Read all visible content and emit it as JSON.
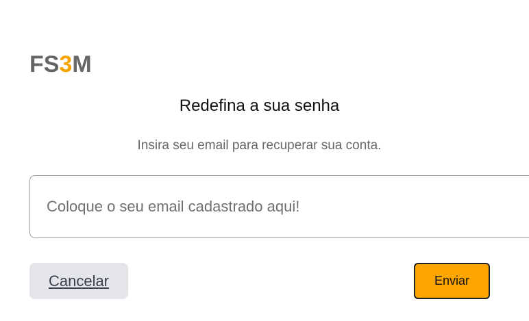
{
  "dialog": {
    "logo": {
      "part1": "FS",
      "part2": "3",
      "part3": "M"
    },
    "title": "Redefina a sua senha",
    "subtitle": "Insira seu email para recuperar sua conta.",
    "email_input": {
      "value": "",
      "placeholder": "Coloque o seu email cadastrado aqui!"
    },
    "cancel_label": "Cancelar",
    "send_label": "Enviar"
  },
  "colors": {
    "accent": "#ffa500",
    "logo_gray": "#666666",
    "cancel_bg": "#e4e5ea"
  }
}
